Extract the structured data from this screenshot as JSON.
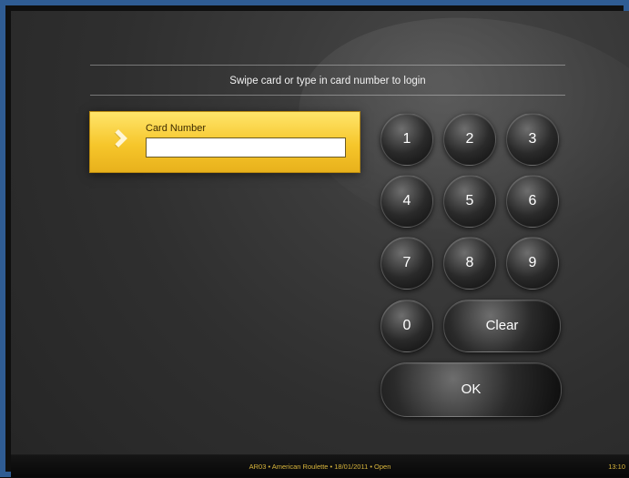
{
  "login": {
    "prompt": "Swipe card or type in card number to login",
    "card_label": "Card Number",
    "card_value": "",
    "card_placeholder": ""
  },
  "keypad": {
    "k1": "1",
    "k2": "2",
    "k3": "3",
    "k4": "4",
    "k5": "5",
    "k6": "6",
    "k7": "7",
    "k8": "8",
    "k9": "9",
    "k0": "0",
    "clear": "Clear",
    "ok": "OK"
  },
  "status_bar": {
    "text": "AR03 • American Roulette • 18/01/2011 • Open",
    "time": "13:10"
  },
  "icons": {
    "card_chevron": "chevron-right-icon"
  },
  "colors": {
    "window_border": "#2f5c93",
    "accent_yellow": "#f6c62b",
    "status_text": "#d8b53c"
  }
}
